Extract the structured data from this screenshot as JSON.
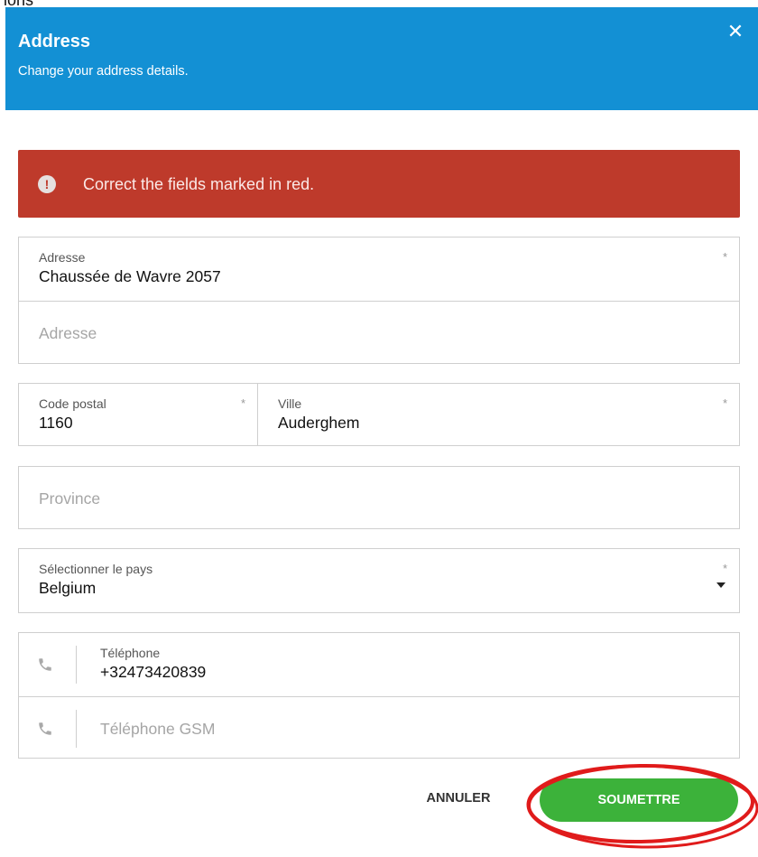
{
  "header": {
    "title": "Address",
    "subtitle": "Change your address details.",
    "close_icon": "close-icon",
    "background": "#1390d4"
  },
  "alert": {
    "icon": "exclamation-icon",
    "message": "Correct the fields marked in red.",
    "background": "#be3a2b"
  },
  "address": {
    "line1": {
      "label": "Adresse",
      "value": "Chaussée de Wavre 2057",
      "required_mark": "*"
    },
    "line2": {
      "placeholder": "Adresse"
    }
  },
  "postal": {
    "label": "Code postal",
    "value": "1160",
    "required_mark": "*"
  },
  "city": {
    "label": "Ville",
    "value": "Auderghem",
    "required_mark": "*"
  },
  "province": {
    "placeholder": "Province"
  },
  "country": {
    "label": "Sélectionner le pays",
    "value": "Belgium",
    "required_mark": "*"
  },
  "phone": {
    "icon": "phone-icon",
    "label": "Téléphone",
    "value": "+32473420839"
  },
  "mobile": {
    "icon": "phone-icon",
    "placeholder": "Téléphone GSM"
  },
  "actions": {
    "cancel_label": "ANNULER",
    "submit_label": "SOUMETTRE",
    "submit_color": "#3cb23a"
  },
  "annotation": {
    "color": "#e01b1b"
  }
}
